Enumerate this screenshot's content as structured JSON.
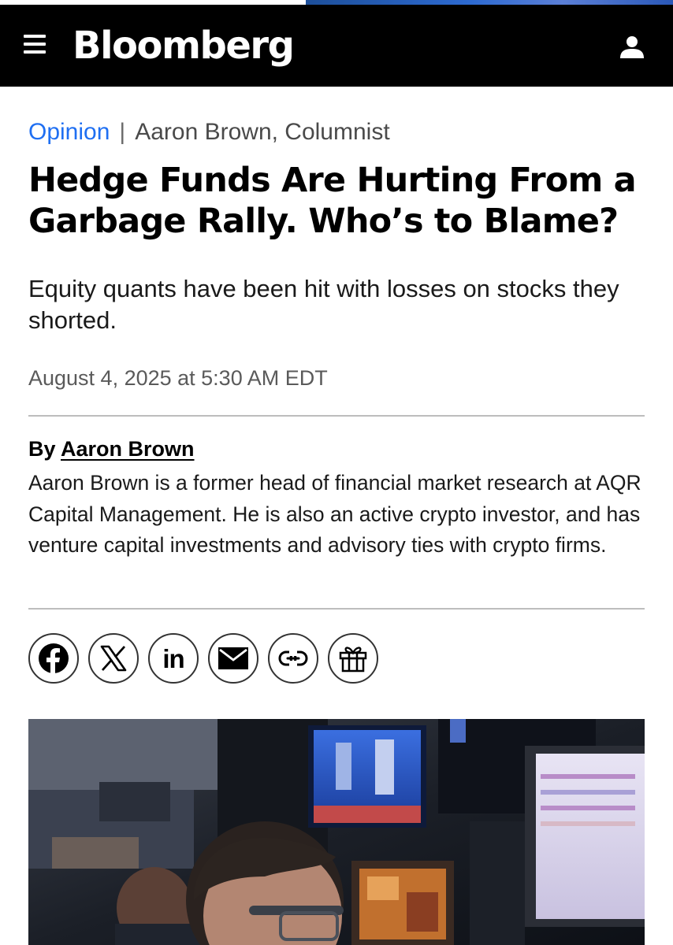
{
  "header": {
    "logo": "Bloomberg",
    "menu_icon": "hamburger-menu-icon",
    "user_icon": "user-account-icon"
  },
  "article": {
    "section": "Opinion",
    "author_role": "Aaron Brown, Columnist",
    "headline": "Hedge Funds Are Hurting From a Garbage Rally. Who’s to Blame?",
    "dek": "Equity quants have been hit with losses on stocks they shorted.",
    "date": "August 4, 2025 at 5:30 AM EDT",
    "byline_prefix": "By",
    "byline_author": "Aaron Brown",
    "bio": "Aaron Brown is a former head of financial market research at AQR Capital Management. He is also an active crypto investor, and has venture capital investments and advisory ties with crypto firms."
  },
  "share": {
    "icons": [
      "facebook-icon",
      "x-icon",
      "linkedin-icon",
      "email-icon",
      "link-icon",
      "gift-icon"
    ]
  },
  "colors": {
    "header_bg": "#000000",
    "opinion_link": "#1f6ff2",
    "rule": "#bdbdbd"
  }
}
